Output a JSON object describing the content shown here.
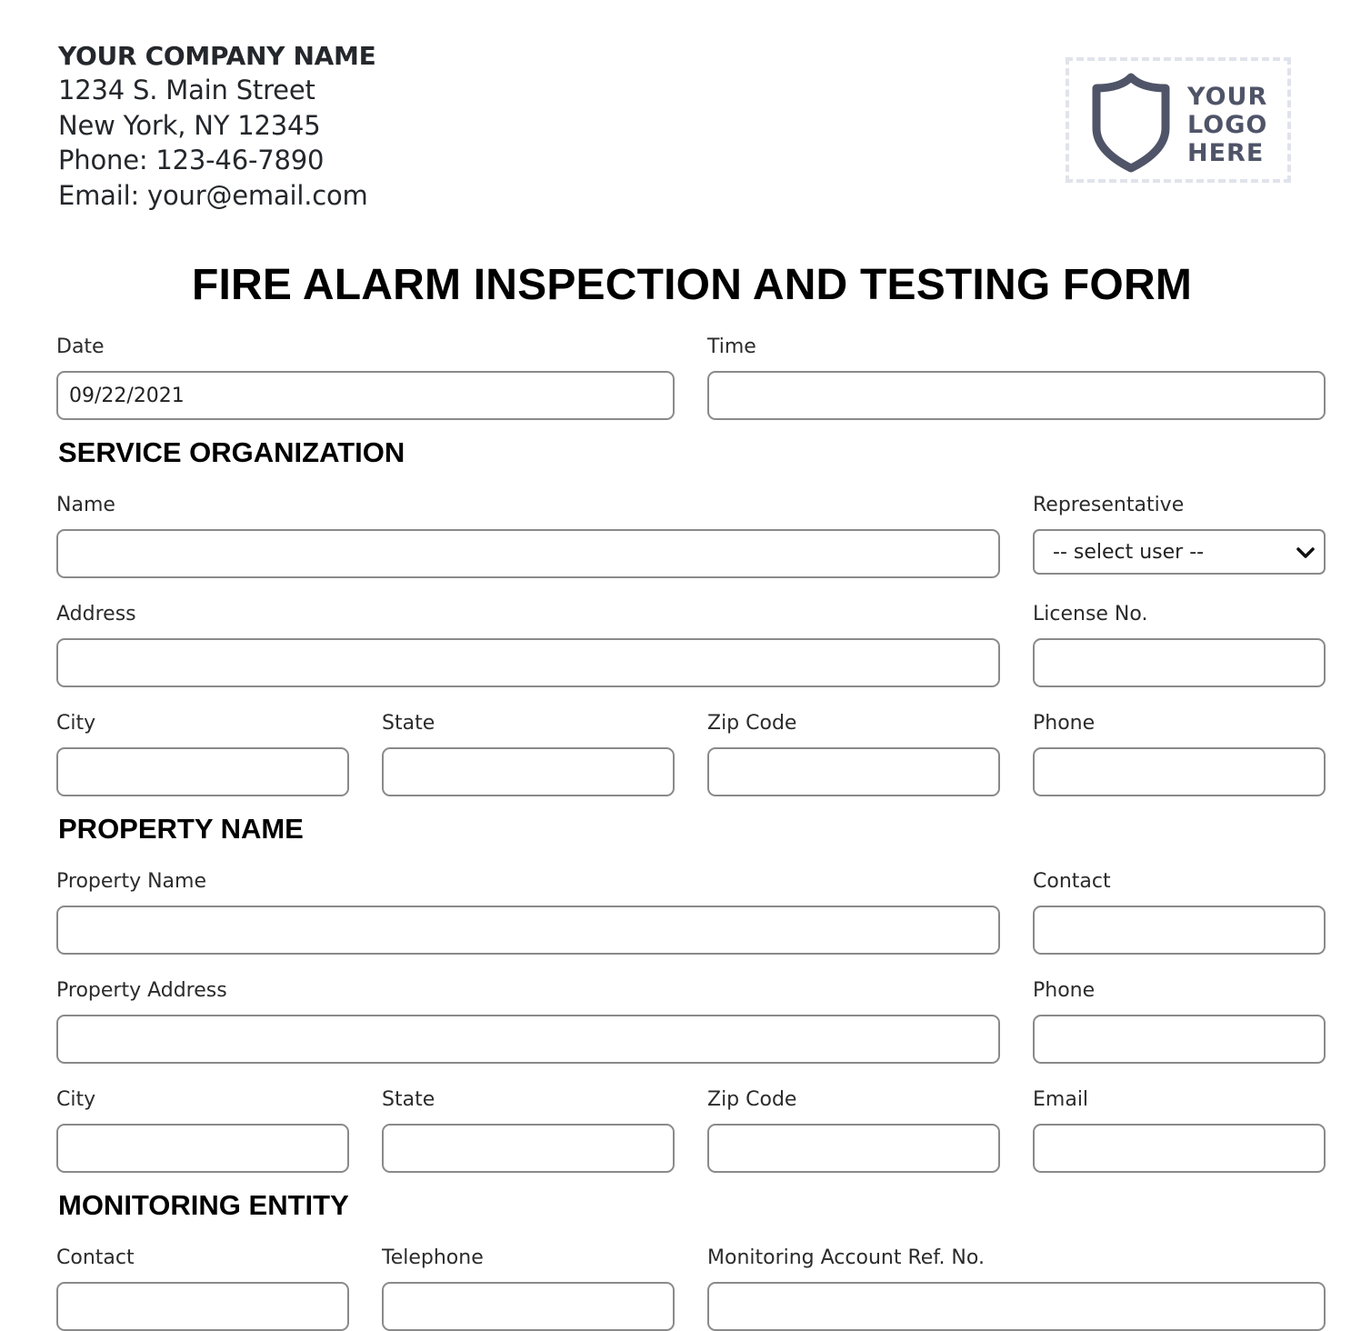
{
  "company": {
    "name": "YOUR COMPANY NAME",
    "street": "1234 S. Main Street",
    "city_line": "New York, NY 12345",
    "phone_line": "Phone: 123-46-7890",
    "email_line": "Email: your@email.com"
  },
  "logo": {
    "icon": "shield-icon",
    "line1": "YOUR",
    "line2": "LOGO",
    "line3": "HERE"
  },
  "form_title": "FIRE ALARM INSPECTION AND TESTING FORM",
  "header_fields": {
    "date": {
      "label": "Date",
      "value": "09/22/2021"
    },
    "time": {
      "label": "Time",
      "value": ""
    }
  },
  "service_organization": {
    "heading": "SERVICE ORGANIZATION",
    "name": {
      "label": "Name",
      "value": ""
    },
    "representative": {
      "label": "Representative",
      "selected": "-- select user --"
    },
    "address": {
      "label": "Address",
      "value": ""
    },
    "license_no": {
      "label": "License No.",
      "value": ""
    },
    "city": {
      "label": "City",
      "value": ""
    },
    "state": {
      "label": "State",
      "value": ""
    },
    "zip": {
      "label": "Zip Code",
      "value": ""
    },
    "phone": {
      "label": "Phone",
      "value": ""
    }
  },
  "property": {
    "heading": "PROPERTY NAME",
    "property_name": {
      "label": "Property Name",
      "value": ""
    },
    "contact": {
      "label": "Contact",
      "value": ""
    },
    "property_address": {
      "label": "Property Address",
      "value": ""
    },
    "phone": {
      "label": "Phone",
      "value": ""
    },
    "city": {
      "label": "City",
      "value": ""
    },
    "state": {
      "label": "State",
      "value": ""
    },
    "zip": {
      "label": "Zip Code",
      "value": ""
    },
    "email": {
      "label": "Email",
      "value": ""
    }
  },
  "monitoring_entity": {
    "heading": "MONITORING ENTITY",
    "contact": {
      "label": "Contact",
      "value": ""
    },
    "telephone": {
      "label": "Telephone",
      "value": ""
    },
    "account_ref": {
      "label": "Monitoring Account Ref. No.",
      "value": ""
    }
  }
}
